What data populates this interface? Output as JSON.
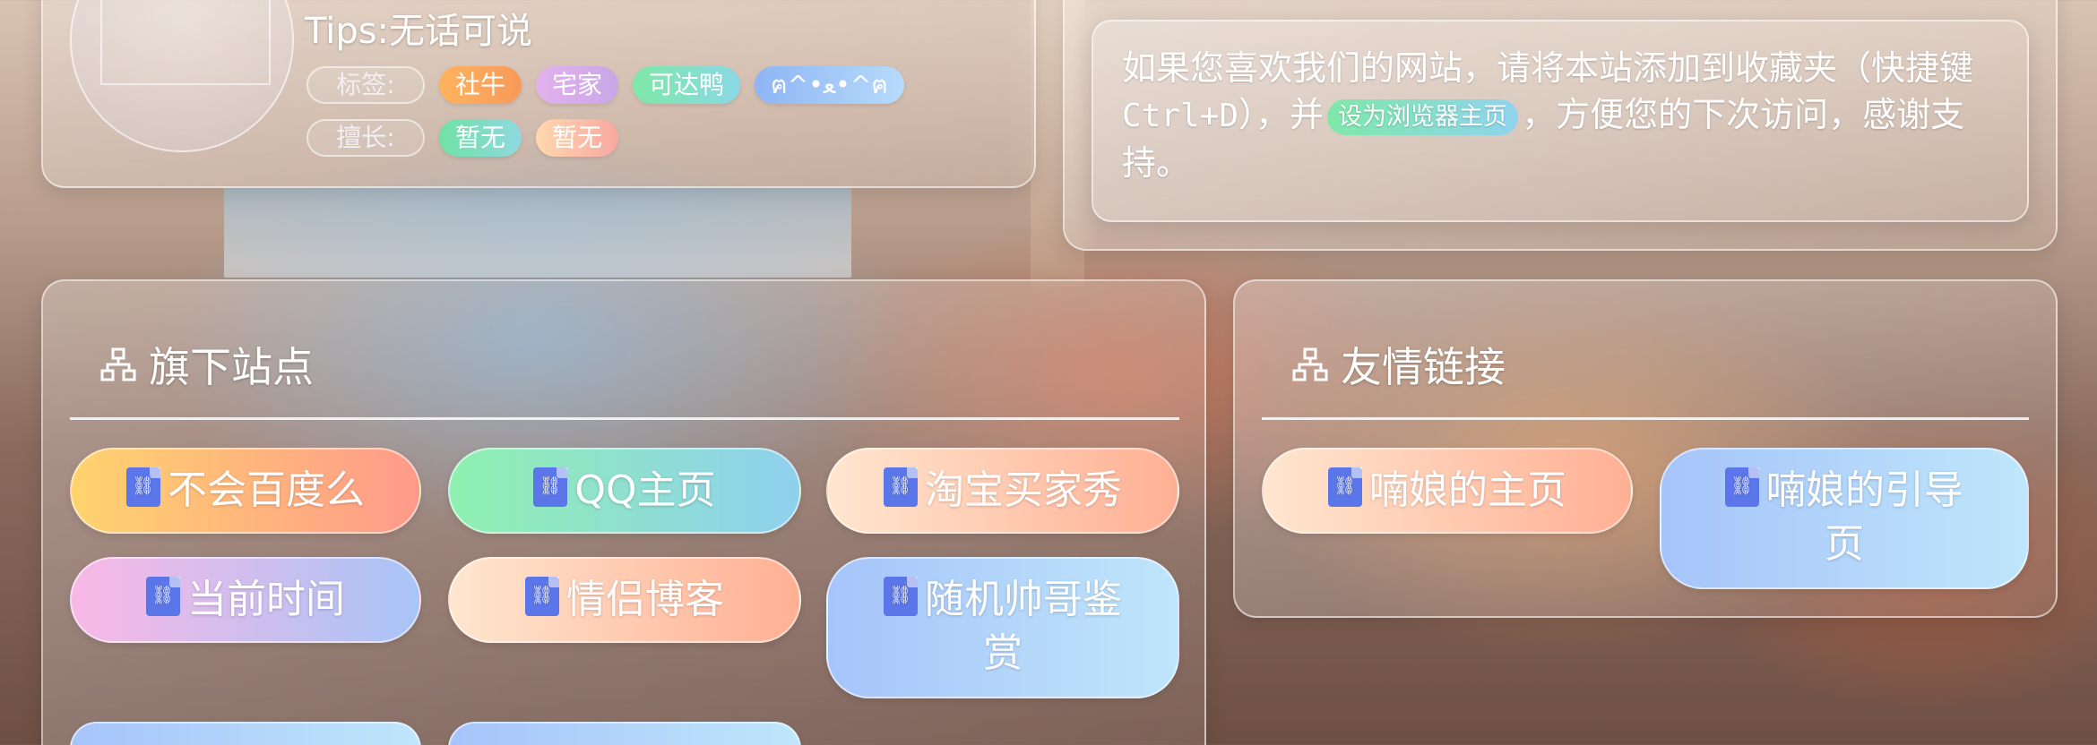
{
  "profile": {
    "tips": "Tips:无话可说",
    "tags_label": "标签:",
    "tags": [
      {
        "text": "社牛",
        "color": "#f8a85a"
      },
      {
        "text": "宅家",
        "color": "#d9a9e6"
      },
      {
        "text": "可达鸭",
        "color": "#7ee6b0"
      },
      {
        "text": "ฅ^•ﻌ•^ฅ",
        "color": "#9cbcf5"
      }
    ],
    "skills_label": "擅长:",
    "skills": [
      {
        "text": "暂无",
        "color": "#6fe2a4"
      },
      {
        "text": "暂无",
        "color": "#f9c3a3"
      }
    ]
  },
  "notice": {
    "text_before": "如果您喜欢我们的网站，请将本站添加到收藏夹（快捷键",
    "shortcut": "Ctrl+D",
    "text_mid": "），并",
    "set_home_button": "设为浏览器主页",
    "text_after": "，方便您的下次访问，感谢支持。"
  },
  "sites": {
    "title": "旗下站点",
    "links": [
      {
        "label": "不会百度么",
        "gradient": [
          "#ffd36e",
          "#ff9a8a"
        ]
      },
      {
        "label": "QQ主页",
        "gradient": [
          "#8ff0b0",
          "#8fd0ee"
        ]
      },
      {
        "label": "淘宝买家秀",
        "gradient": [
          "#ffe6cf",
          "#ffb094"
        ]
      },
      {
        "label": "当前时间",
        "gradient": [
          "#f9b8e6",
          "#a8c4f6"
        ]
      },
      {
        "label": "情侣博客",
        "gradient": [
          "#ffe6cf",
          "#ffb094"
        ]
      },
      {
        "label": "随机帅哥鉴赏",
        "gradient": [
          "#a6c4fa",
          "#bfe6fb"
        ]
      }
    ]
  },
  "friends": {
    "title": "友情链接",
    "links": [
      {
        "label": "喃娘的主页",
        "gradient": [
          "#ffe6cf",
          "#ffb094"
        ]
      },
      {
        "label": "喃娘的引导页",
        "gradient": [
          "#a6c4fa",
          "#bfe6fb"
        ]
      }
    ]
  },
  "icons": {
    "section": "sitemap-icon",
    "link": "link-file-icon"
  }
}
